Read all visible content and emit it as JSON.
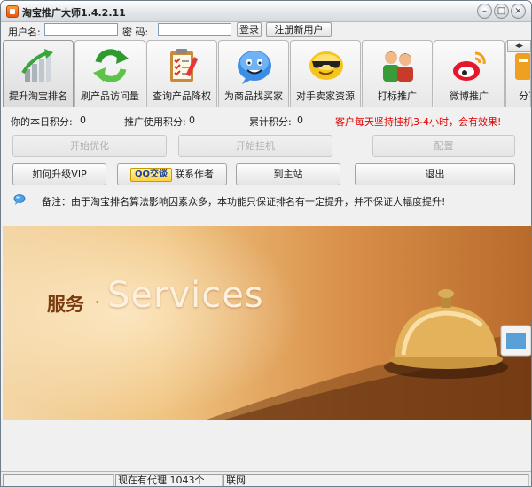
{
  "window": {
    "title": "淘宝推广大师1.4.2.11",
    "minimize_glyph": "–",
    "maximize_glyph": "□",
    "close_glyph": "×"
  },
  "login": {
    "username_label": "用户名:",
    "username_value": "",
    "password_label": "密  码:",
    "password_value": "",
    "login_button": "登录",
    "register_button": "注册新用户"
  },
  "tabs": [
    {
      "label": "提升淘宝排名",
      "icon": "bar-chart-icon",
      "active": true
    },
    {
      "label": "刷产品访问量",
      "icon": "refresh-arrows-icon",
      "active": false
    },
    {
      "label": "查询产品降权",
      "icon": "clipboard-checklist-icon",
      "active": false
    },
    {
      "label": "为商品找买家",
      "icon": "smiley-speech-icon",
      "active": false
    },
    {
      "label": "对手卖家资源",
      "icon": "cool-face-icon",
      "active": false
    },
    {
      "label": "打标推广",
      "icon": "people-icon",
      "active": false
    },
    {
      "label": "微博推广",
      "icon": "weibo-icon",
      "active": false
    },
    {
      "label": "分享",
      "icon": "share-icon",
      "active": false
    }
  ],
  "tab_scroll": "◂▸",
  "points": {
    "today_label": "你的本日积分:",
    "today_value": "0",
    "promo_label": "推广使用积分:",
    "promo_value": "0",
    "total_label": "累计积分:",
    "total_value": "0",
    "notice": "客户每天坚持挂机3-4小时，会有效果!"
  },
  "actions": {
    "start_optimize": "开始优化",
    "start_hangup": "开始挂机",
    "config": "配置",
    "upgrade_vip": "如何升级VIP",
    "qq_badge": "QQ交谈",
    "contact_author": "联系作者",
    "go_home": "到主站",
    "exit": "退出"
  },
  "note": {
    "text": "备注：由于淘宝排名算法影响因素众多，本功能只保证排名有一定提升，并不保证大幅度提升!"
  },
  "banner": {
    "cn_text": "服务",
    "separator": "·",
    "en_text": "Services"
  },
  "status": {
    "proxy_text": "现在有代理 1043个",
    "network_text": "联网"
  }
}
